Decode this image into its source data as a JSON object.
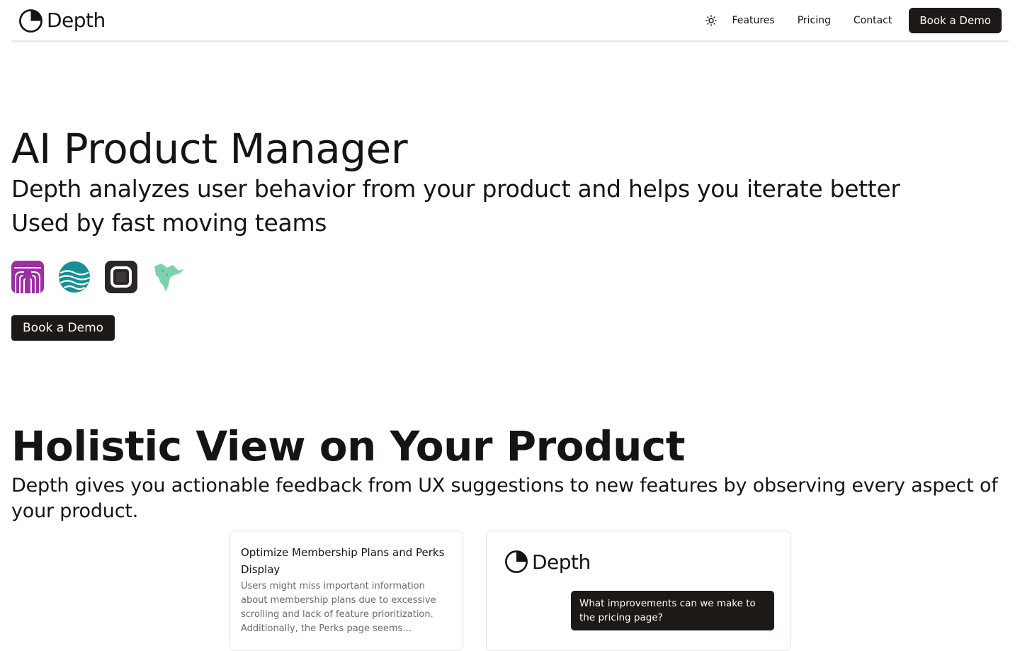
{
  "nav": {
    "brand": "Depth",
    "links": [
      "Features",
      "Pricing",
      "Contact"
    ],
    "cta": "Book a Demo",
    "theme_icon": "sun-icon"
  },
  "hero": {
    "title": "AI Product Manager",
    "subtitle": "Depth analyzes user behavior from your product and helps you iterate better",
    "social_proof": "Used by fast moving teams",
    "customer_logos": [
      "purple-arches-logo",
      "teal-waves-logo",
      "dark-rounded-square-logo",
      "green-bird-logo"
    ],
    "cta": "Book a Demo"
  },
  "holistic": {
    "title": "Holistic View on Your Product",
    "subtitle": "Depth gives you actionable feedback from UX suggestions to new features by observing every aspect of your product.",
    "suggestion_card": {
      "title": "Optimize Membership Plans and Perks Display",
      "body": "Users might miss important information about membership plans due to excessive scrolling and lack of feature prioritization. Additionally, the Perks page seems overloaded, making it difficult to digest."
    },
    "chat_card": {
      "brand": "Depth",
      "question": "What improvements can we make to the pricing page?"
    }
  },
  "colors": {
    "dark": "#1c1917",
    "purple_logo": "#9b2fa3",
    "teal_logo": "#168f95",
    "green_logo": "#7ed1ad"
  }
}
